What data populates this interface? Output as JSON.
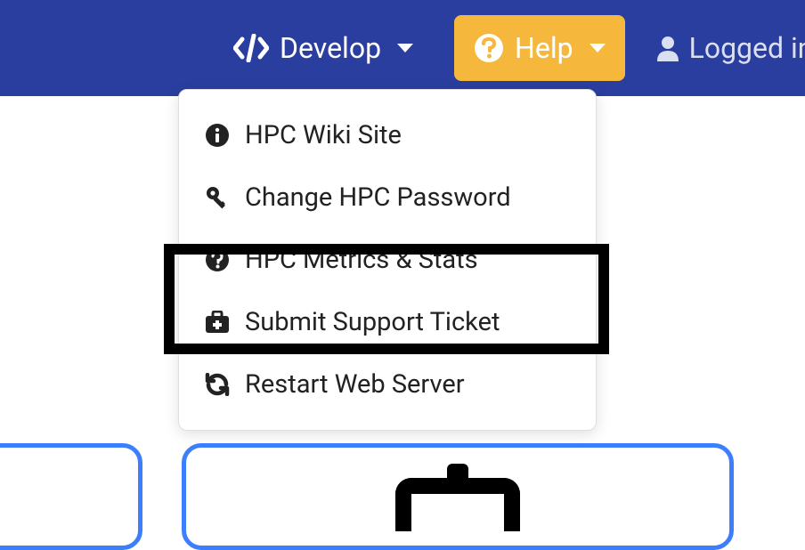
{
  "navbar": {
    "develop_label": "Develop",
    "help_label": "Help",
    "logged_in_label": "Logged in a"
  },
  "dropdown": {
    "items": [
      {
        "icon": "info-circle-icon",
        "label": "HPC Wiki Site"
      },
      {
        "icon": "key-icon",
        "label": "Change HPC Password"
      },
      {
        "icon": "question-circle-icon",
        "label": "HPC Metrics & Stats"
      },
      {
        "icon": "medkit-icon",
        "label": "Submit Support Ticket"
      },
      {
        "icon": "sync-icon",
        "label": "Restart Web Server"
      }
    ]
  }
}
